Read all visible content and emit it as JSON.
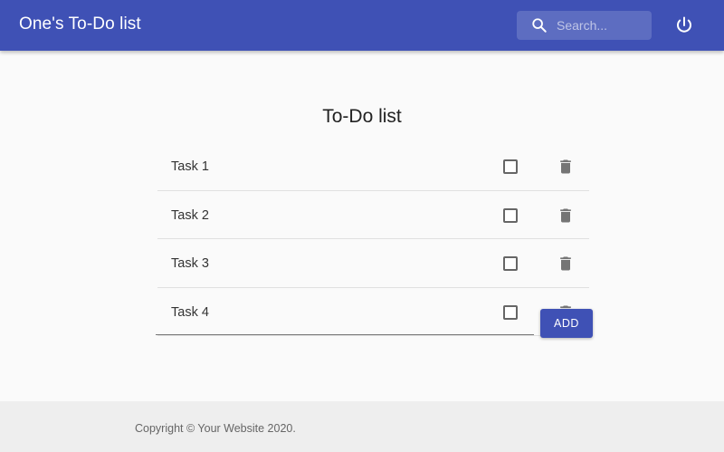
{
  "header": {
    "title": "One's To-Do list",
    "search_placeholder": "Search...",
    "search_icon": "search-icon",
    "power_icon": "power-icon"
  },
  "main": {
    "title": "To-Do list",
    "tasks": [
      {
        "label": "Task 1",
        "checked": false
      },
      {
        "label": "Task 2",
        "checked": false
      },
      {
        "label": "Task 3",
        "checked": false
      },
      {
        "label": "Task 4",
        "checked": false
      }
    ],
    "new_task_value": "",
    "add_label": "ADD",
    "delete_icon": "trash-icon"
  },
  "footer": {
    "copyright": "Copyright © Your Website 2020."
  },
  "colors": {
    "primary": "#3f51b5",
    "background": "#fafafa",
    "footer": "#eeeeee"
  }
}
